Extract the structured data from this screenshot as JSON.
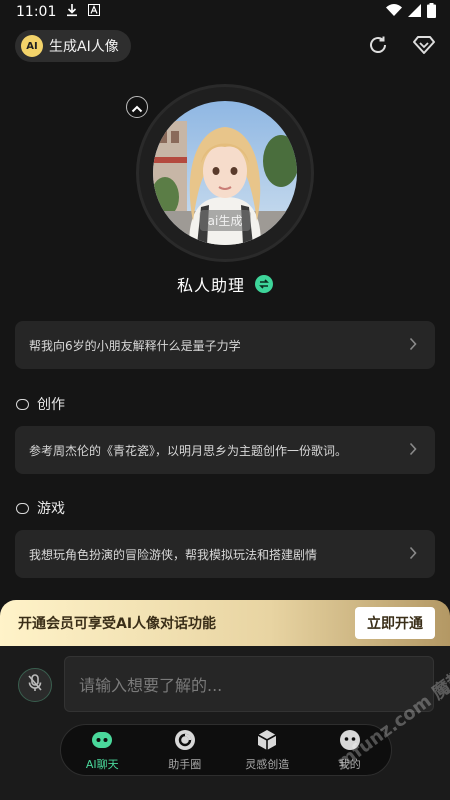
{
  "status": {
    "time": "11:01"
  },
  "header": {
    "generate_label": "生成AI人像",
    "ai_badge": "AI"
  },
  "profile": {
    "avatar_tag": "ai生成",
    "name": "私人助理"
  },
  "suggestions": [
    {
      "text": "帮我向6岁的小朋友解释什么是量子力学"
    },
    {
      "section": "创作",
      "text": "参考周杰伦的《青花瓷》，以明月思乡为主题创作一份歌词。"
    },
    {
      "section": "游戏",
      "text": "我想玩角色扮演的冒险游侠，帮我模拟玩法和搭建剧情"
    }
  ],
  "promo": {
    "text": "开通会员可享受AI人像对话功能",
    "button": "立即开通"
  },
  "input": {
    "placeholder": "请输入想要了解的..."
  },
  "tabs": [
    {
      "label": "AI聊天",
      "active": true
    },
    {
      "label": "助手圈",
      "active": false
    },
    {
      "label": "灵感创造",
      "active": false
    },
    {
      "label": "我的",
      "active": false
    }
  ],
  "watermark": "mfunz.com 魔趣网",
  "colors": {
    "accent": "#4ad89b",
    "promo_gold": "#e8d4a2",
    "background": "#151515"
  }
}
